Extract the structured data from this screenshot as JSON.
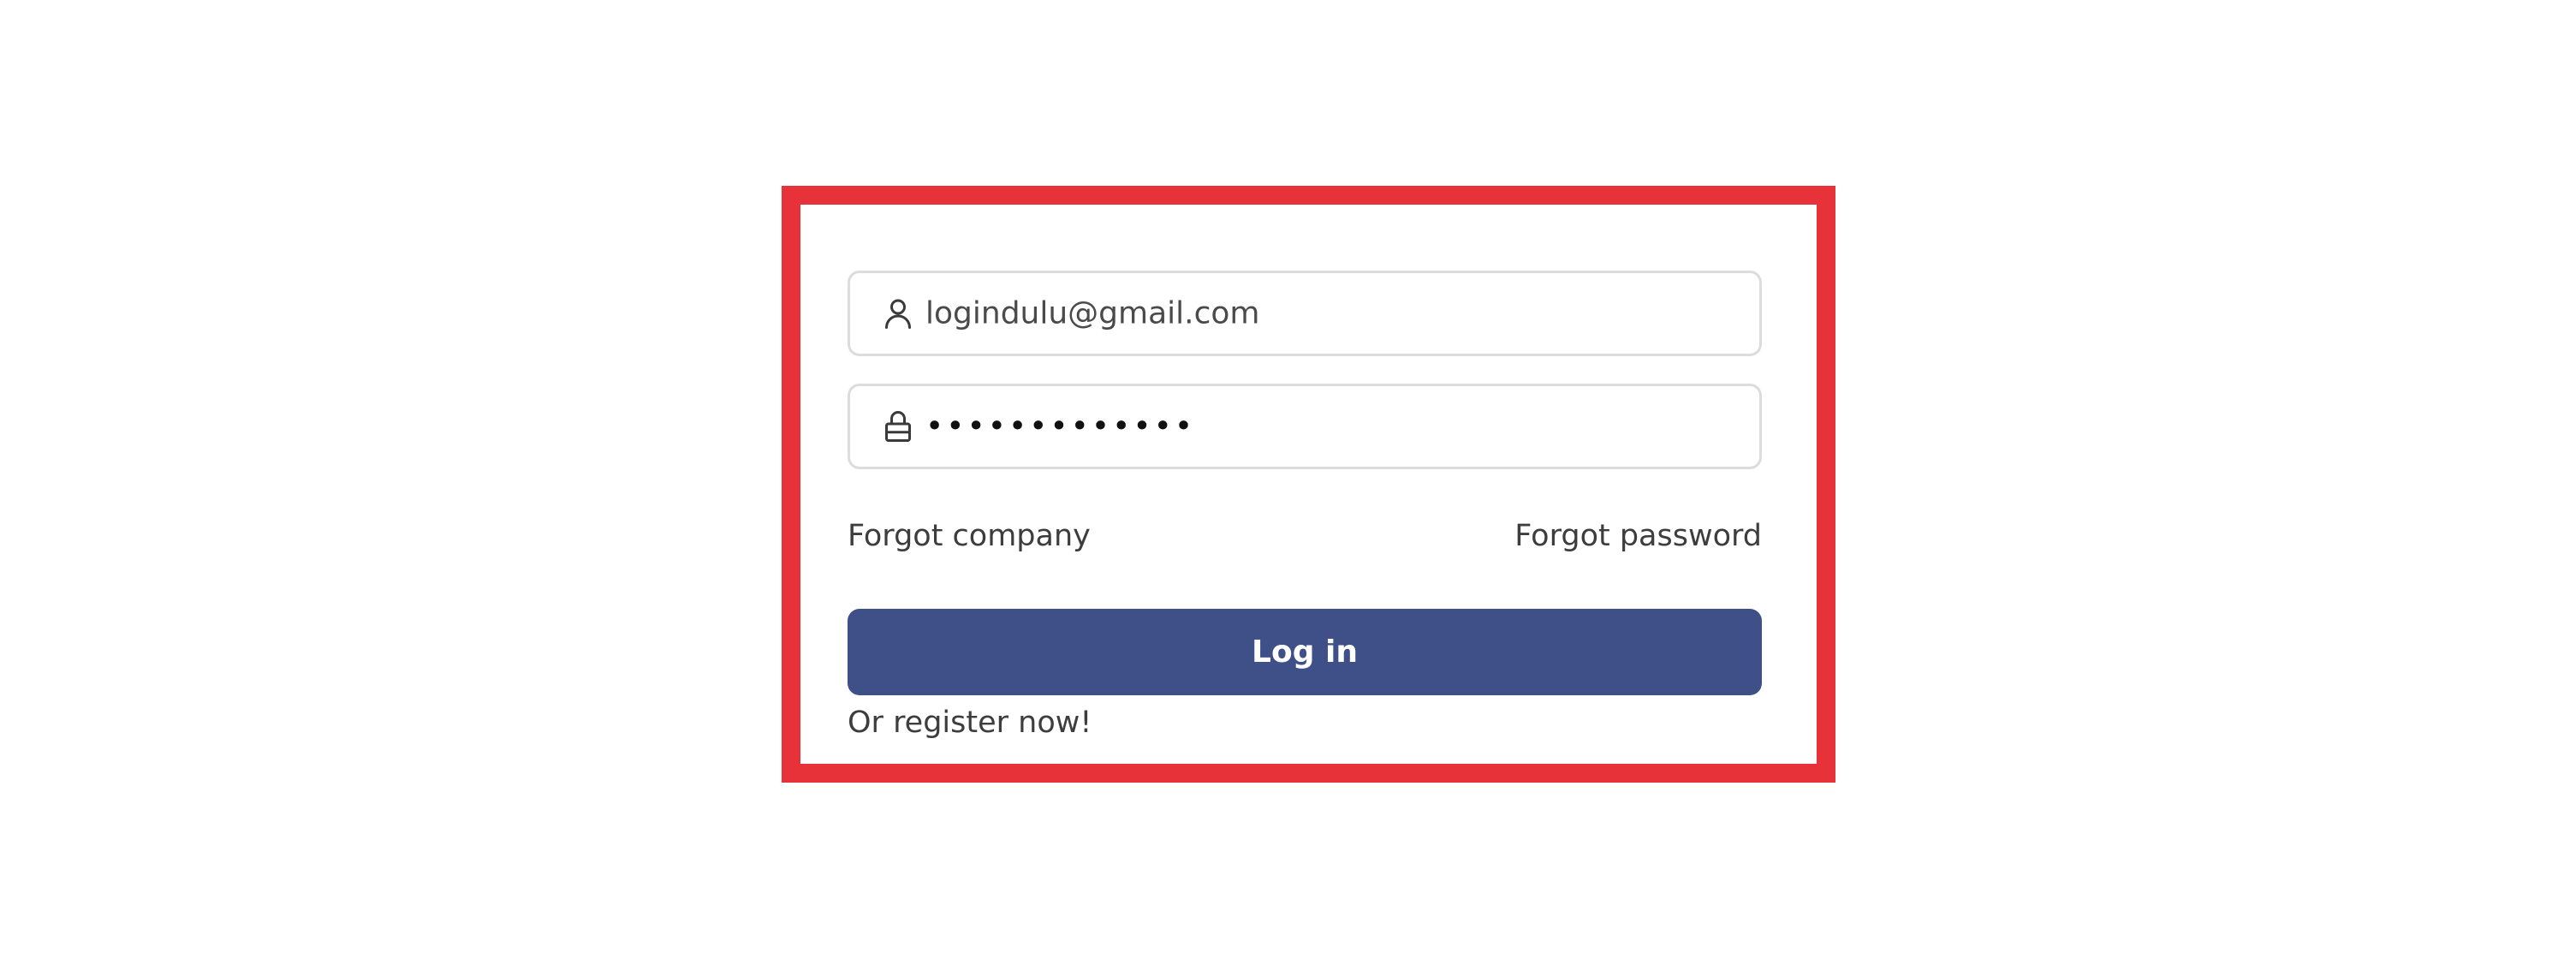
{
  "login": {
    "email": {
      "icon": "user-icon",
      "value": "logindulu@gmail.com"
    },
    "password": {
      "icon": "lock-icon",
      "value": "•••••••••••••"
    },
    "forgot_company": "Forgot company",
    "forgot_password": "Forgot password",
    "login_button": "Log in",
    "register_link": "Or register now!"
  },
  "colors": {
    "highlight_border": "#e8323a",
    "button_bg": "#3f5089",
    "button_text": "#ffffff",
    "field_border": "#dcdcdc",
    "text": "#3d3d3d"
  }
}
